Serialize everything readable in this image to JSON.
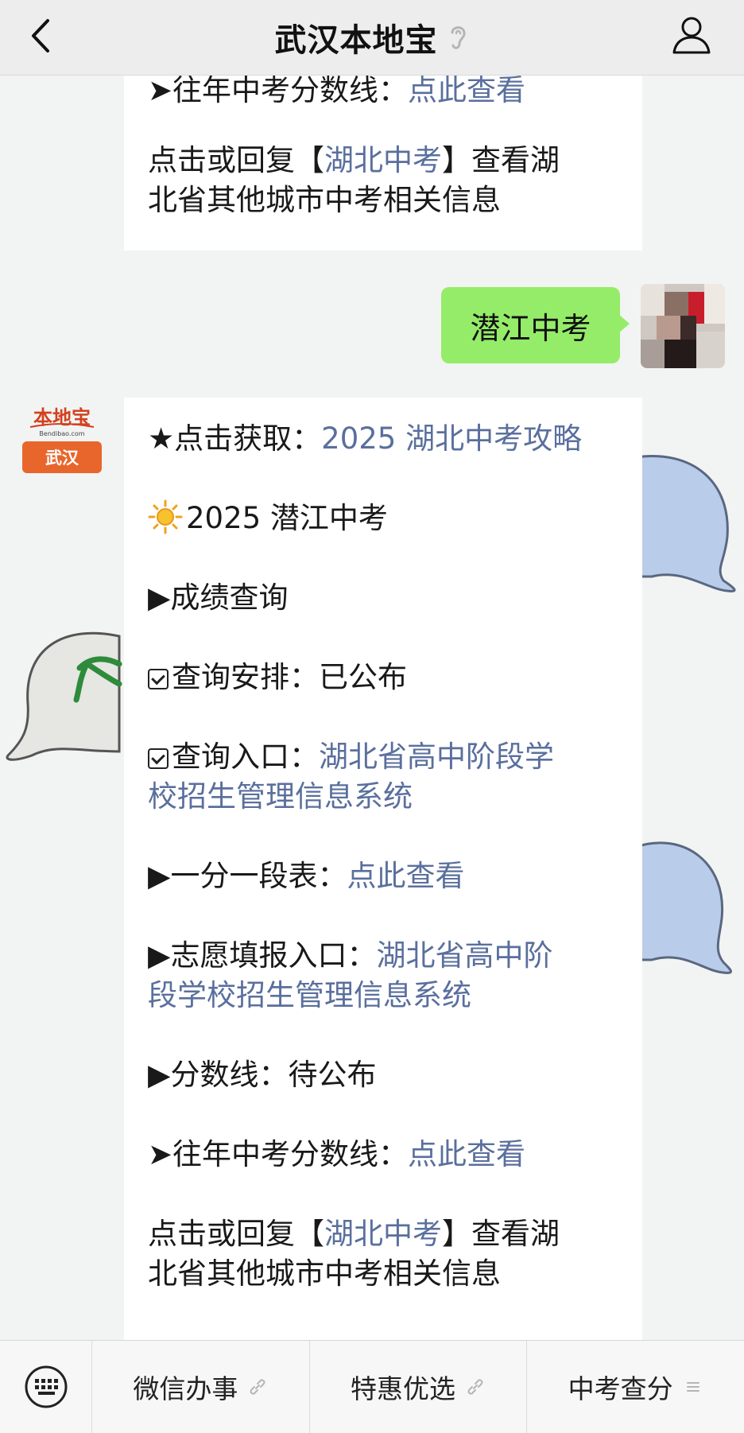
{
  "header": {
    "title": "武汉本地宝"
  },
  "brand": {
    "logo_text": "本地宝",
    "logo_sub": "Bendibao.com",
    "logo_city": "武汉"
  },
  "top_message": {
    "line1": {
      "prefix": "➤往年中考分数线：",
      "link": "点此查看"
    },
    "line2": {
      "pre": "点击或回复【",
      "link": "湖北中考",
      "post": "】查看湖"
    },
    "line3": "北省其他城市中考相关信息"
  },
  "outgoing": {
    "text": "潜江中考"
  },
  "main_message": {
    "l1": {
      "prefix": "★点击获取：",
      "link": "2025 湖北中考攻略"
    },
    "l2": "2025 潜江中考",
    "l3": "▶成绩查询",
    "l4": {
      "label": "查询安排：",
      "value": "已公布"
    },
    "l5": {
      "label": "查询入口：",
      "link": "湖北省高中阶段学"
    },
    "l6": {
      "link": "校招生管理信息系统"
    },
    "l7": {
      "prefix": "▶一分一段表：",
      "link": "点此查看"
    },
    "l8": {
      "prefix": "▶志愿填报入口：",
      "link": "湖北省高中阶"
    },
    "l9": {
      "link": "段学校招生管理信息系统"
    },
    "l10": {
      "prefix": "▶分数线：",
      "value": "待公布"
    },
    "l11": {
      "prefix": "➤往年中考分数线：",
      "link": "点此查看"
    },
    "l12": {
      "pre": "点击或回复【",
      "link": "湖北中考",
      "post": "】查看湖"
    },
    "l13": "北省其他城市中考相关信息"
  },
  "bottom_menu": {
    "items": [
      {
        "label": "微信办事",
        "icon": "link-icon"
      },
      {
        "label": "特惠优选",
        "icon": "link-icon"
      },
      {
        "label": "中考查分",
        "icon": "list-icon"
      }
    ]
  },
  "colors": {
    "link": "#5a6f9d",
    "bubble": "#95ec69",
    "brand_orange": "#e8662c"
  }
}
